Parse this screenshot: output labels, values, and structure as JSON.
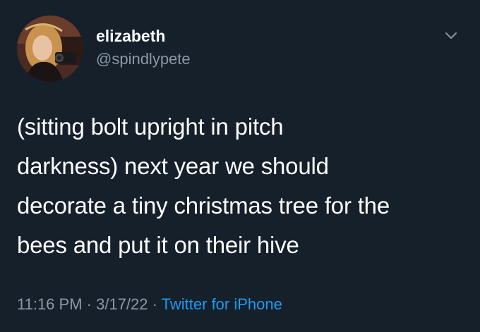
{
  "user": {
    "display_name": "elizabeth",
    "handle": "@spindlypete"
  },
  "tweet": {
    "lines": [
      "(sitting bolt upright in pitch",
      "darkness) next year we should",
      "decorate a tiny christmas tree for the",
      "bees and put it on their hive"
    ]
  },
  "meta": {
    "time": "11:16 PM",
    "separator": " · ",
    "date": "3/17/22",
    "source": "Twitter for iPhone"
  },
  "icons": {
    "more": "chevron-down-icon"
  },
  "colors": {
    "background": "#15202b",
    "text": "#ffffff",
    "secondary": "#8b98a5",
    "link": "#1d9bf0"
  }
}
